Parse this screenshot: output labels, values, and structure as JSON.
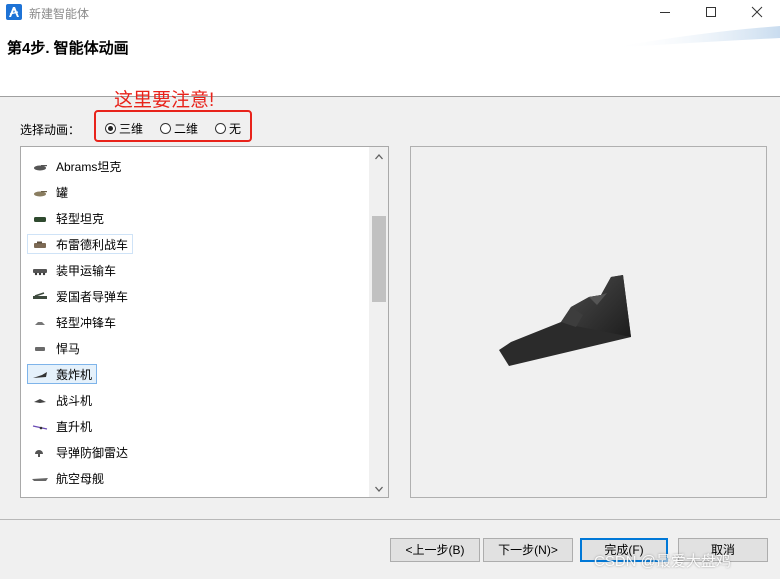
{
  "window": {
    "title": "新建智能体"
  },
  "header": {
    "step_title": "第4步. 智能体动画"
  },
  "annotation": {
    "note": "这里要注意!"
  },
  "animation": {
    "label": "选择动画：",
    "options": [
      {
        "label": "三维",
        "checked": true
      },
      {
        "label": "二维",
        "checked": false
      },
      {
        "label": "无",
        "checked": false
      }
    ]
  },
  "list": {
    "items": [
      {
        "label": "Abrams坦克",
        "icon": "tank-icon"
      },
      {
        "label": "罐",
        "icon": "tank-icon"
      },
      {
        "label": "轻型坦克",
        "icon": "tank-icon"
      },
      {
        "label": "布雷德利战车",
        "icon": "combat-vehicle-icon"
      },
      {
        "label": "装甲运输车",
        "icon": "armored-carrier-icon"
      },
      {
        "label": "爱国者导弹车",
        "icon": "missile-truck-icon"
      },
      {
        "label": "轻型冲锋车",
        "icon": "assault-vehicle-icon"
      },
      {
        "label": "悍马",
        "icon": "humvee-icon"
      },
      {
        "label": "轰炸机",
        "icon": "bomber-icon"
      },
      {
        "label": "战斗机",
        "icon": "fighter-jet-icon"
      },
      {
        "label": "直升机",
        "icon": "helicopter-icon"
      },
      {
        "label": "导弹防御雷达",
        "icon": "radar-icon"
      },
      {
        "label": "航空母舰",
        "icon": "aircraft-carrier-icon"
      }
    ],
    "selected_index": 8
  },
  "buttons": {
    "back": "<上一步(B)",
    "next": "下一步(N)>",
    "finish": "完成(F)",
    "cancel": "取消"
  },
  "watermark": "CSDN @最爱大盘鸡",
  "colors": {
    "annotation": "#e8231b",
    "selection": "#e5f1fb",
    "accent": "#0078d7"
  }
}
